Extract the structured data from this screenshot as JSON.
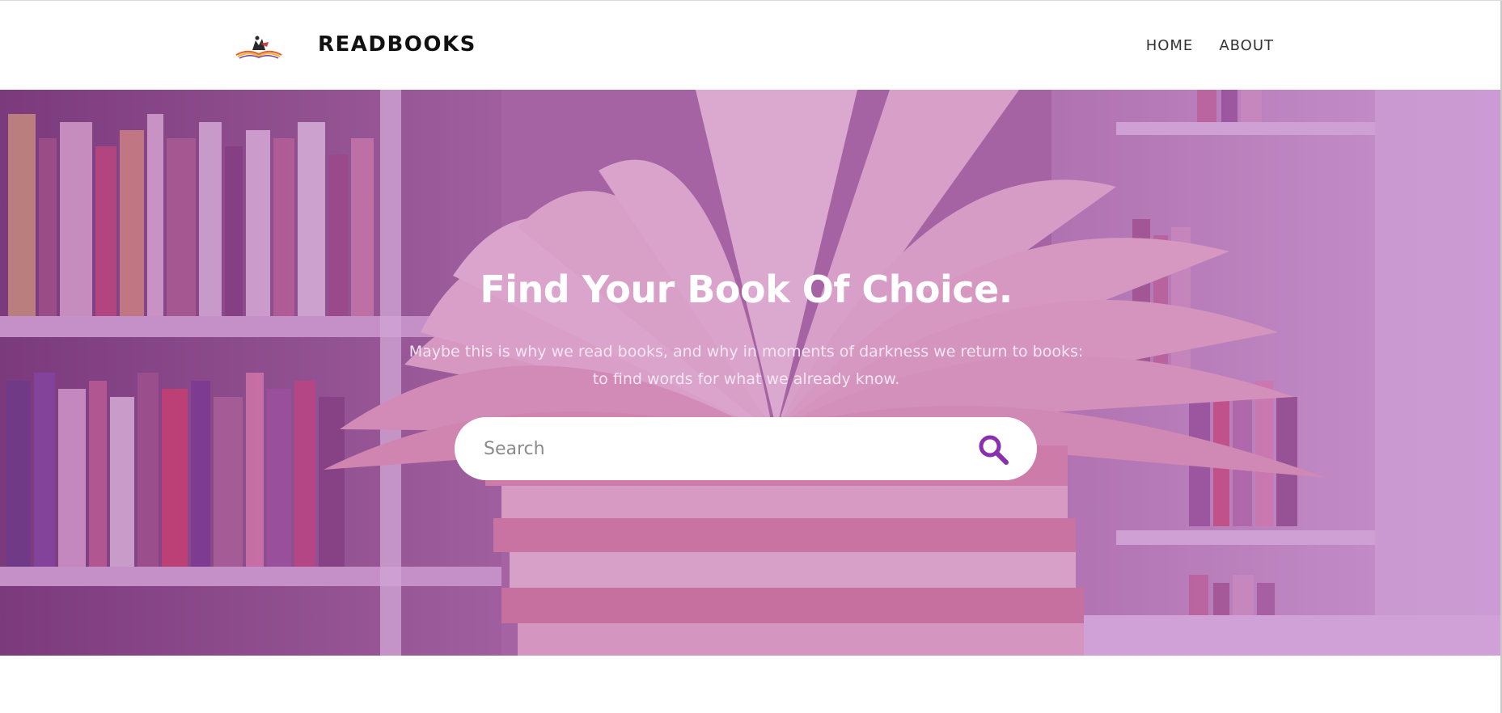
{
  "header": {
    "brand": "READBOOKS",
    "nav": [
      {
        "label": "HOME"
      },
      {
        "label": "ABOUT"
      }
    ]
  },
  "hero": {
    "title": "Find Your Book Of Choice.",
    "subtitle_line1": "Maybe this is why we read books, and why in moments of darkness we return to books:",
    "subtitle_line2": "to find words for what we already know.",
    "search": {
      "placeholder": "Search",
      "value": "",
      "icon": "search-icon"
    }
  },
  "colors": {
    "accent": "#8a2fb0",
    "overlay": "#a03caa",
    "title": "#ffffff"
  }
}
